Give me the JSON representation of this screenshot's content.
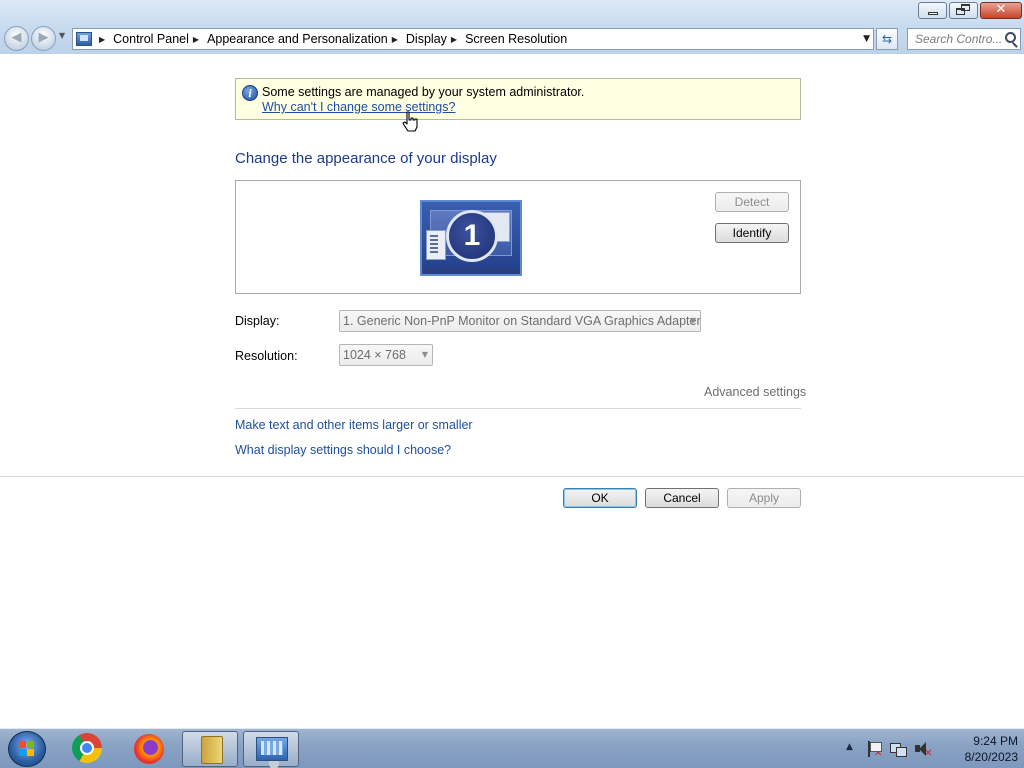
{
  "window": {
    "caption_buttons": {
      "minimize": "minimize",
      "maximize": "restore",
      "close": "close"
    }
  },
  "navigation": {
    "back_icon": "back-arrow-icon",
    "forward_icon": "forward-arrow-icon",
    "breadcrumbs": [
      "Control Panel",
      "Appearance and Personalization",
      "Display",
      "Screen Resolution"
    ],
    "search_placeholder": "Search Contro..."
  },
  "infobar": {
    "message": "Some settings are managed by your system administrator.",
    "link": "Why can't I change some settings?"
  },
  "page": {
    "heading": "Change the appearance of your display",
    "detect_label": "Detect",
    "identify_label": "Identify",
    "monitor_number": "1",
    "display_label": "Display:",
    "display_value": "1. Generic Non-PnP Monitor on Standard VGA Graphics Adapter",
    "resolution_label": "Resolution:",
    "resolution_value": "1024 × 768",
    "advanced_link": "Advanced settings",
    "links": [
      "Make text and other items larger or smaller",
      "What display settings should I choose?"
    ],
    "ok_label": "OK",
    "cancel_label": "Cancel",
    "apply_label": "Apply"
  },
  "taskbar": {
    "apps": [
      "start-orb",
      "chrome",
      "firefox",
      "file-explorer",
      "control-panel"
    ],
    "time": "9:24 PM",
    "date": "8/20/2023"
  },
  "colors": {
    "accent_blue": "#1e4fa0",
    "heading_blue": "#1e3a8a",
    "info_bg": "#ffffe1"
  }
}
